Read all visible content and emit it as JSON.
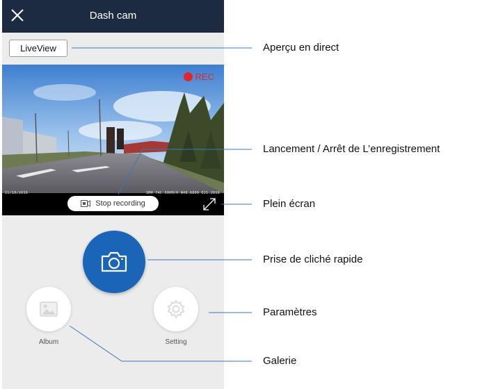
{
  "app": {
    "title": "Dash cam",
    "close_icon": "close-icon"
  },
  "toolbar": {
    "liveview_label": "LiveView"
  },
  "preview": {
    "rec_label": "REC",
    "rec_color": "#e0262b",
    "osd_left": "11/10/2016",
    "osd_right": "SMH 7AC 50KM/H N48.6860 E21.2810",
    "stop_label": "Stop recording",
    "stop_icon": "video-camera-icon",
    "fullscreen_icon": "expand-icon"
  },
  "actions": {
    "snapshot_icon": "camera-icon",
    "snapshot_color": "#1a65b8",
    "album_label": "Album",
    "album_icon": "image-icon",
    "setting_label": "Setting",
    "setting_icon": "gear-icon"
  },
  "callouts": [
    {
      "id": "liveview",
      "text": "Aperçu en direct"
    },
    {
      "id": "record",
      "text": "Lancement / Arrêt de L’enregistrement"
    },
    {
      "id": "fullscreen",
      "text": "Plein écran"
    },
    {
      "id": "snapshot",
      "text": "Prise de cliché rapide"
    },
    {
      "id": "settings",
      "text": "Paramètres"
    },
    {
      "id": "gallery",
      "text": "Galerie"
    }
  ]
}
